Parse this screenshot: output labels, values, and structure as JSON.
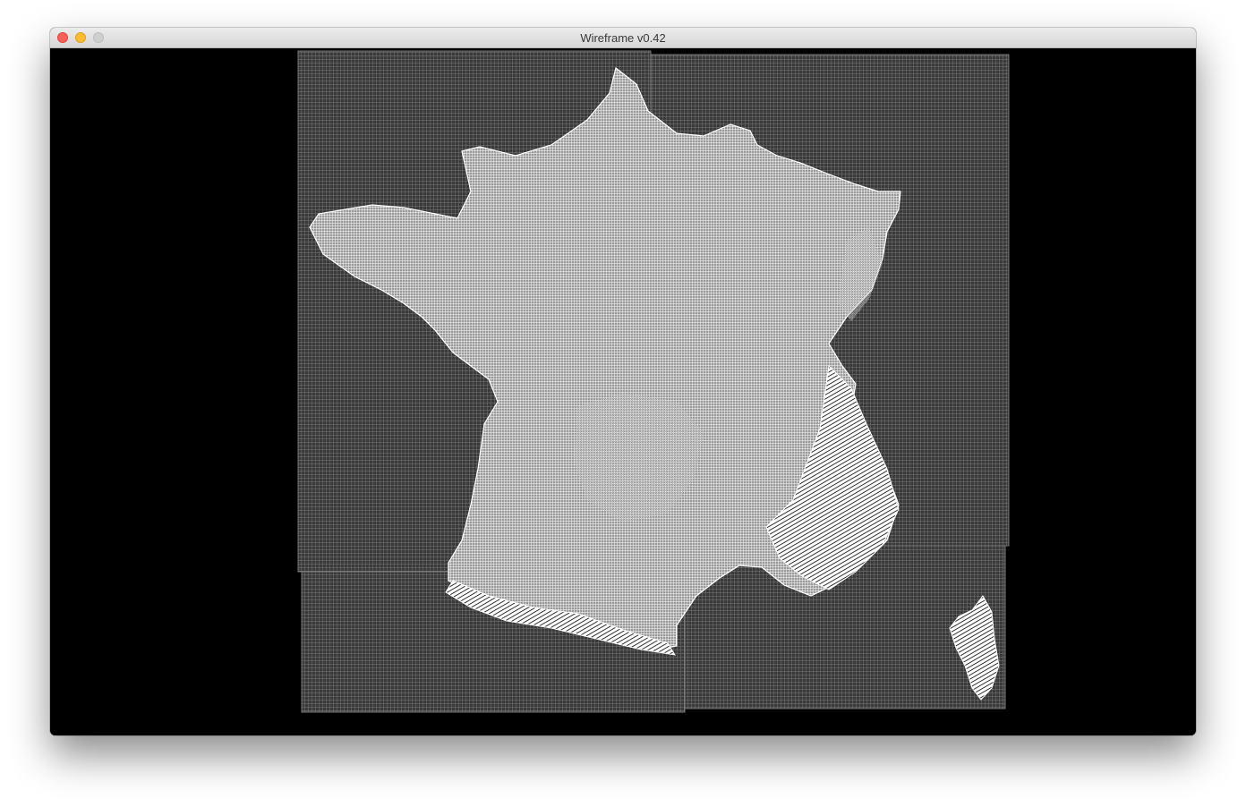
{
  "window": {
    "title": "Wireframe v0.42"
  },
  "colors": {
    "background": "#000000",
    "tile_fill": "#3c3c3c",
    "grid_line": "#8a8a8a",
    "terrain": "#ffffff"
  },
  "icons": {
    "close": "close-icon",
    "minimize": "minimize-icon",
    "zoom": "zoom-icon"
  }
}
